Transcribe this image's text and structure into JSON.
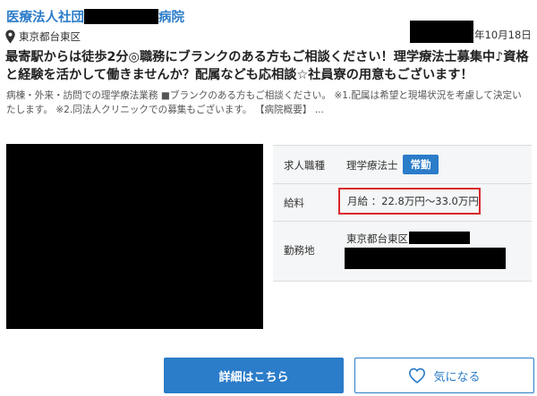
{
  "clinic": {
    "name_prefix": "医療法人社団",
    "name_suffix": "病院"
  },
  "location": {
    "icon": "map-pin-icon",
    "area": "東京都台東区"
  },
  "posted_date": "年10月18日",
  "headline": "最寄駅からは徒歩2分◎職務にブランクのある方もご相談ください！理学療法士募集中♪資格と経験を活かして働きませんか？配属なども応相談☆社員寮の用意もございます！",
  "description": "病棟・外来・訪問での理学療法業務 ■ブランクのある方もご相談ください。 ※1.配属は希望と現場状況を考慮して決定いたします。 ※2.同法人クリニックでの募集もございます。 【病院概要】 ...",
  "info": {
    "job_label": "求人職種",
    "job_value": "理学療法士",
    "employment_badge": "常勤",
    "salary_label": "給料",
    "salary_value": "月給 ：22.8万円〜33.0万円",
    "workplace_label": "勤務地",
    "workplace_value": "東京都台東区"
  },
  "buttons": {
    "detail": "詳細はこちら",
    "favorite": "気になる",
    "favorite_icon": "heart-icon"
  },
  "colors": {
    "accent": "#2b7cc9",
    "highlight_border": "#d9262c"
  }
}
